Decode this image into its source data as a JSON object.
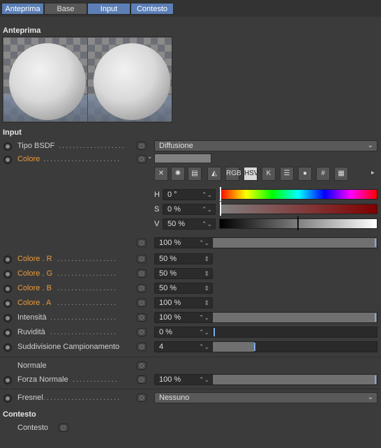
{
  "tabs": [
    {
      "label": "Anteprima",
      "active": true
    },
    {
      "label": "Base",
      "active": false
    },
    {
      "label": "Input",
      "active": true
    },
    {
      "label": "Contesto",
      "active": true
    }
  ],
  "preview": {
    "title": "Anteprima"
  },
  "input": {
    "title": "Input",
    "tipo_bsdf": {
      "label": "Tipo BSDF",
      "value": "Diffusione"
    },
    "colore": {
      "label": "Colore",
      "hsv": {
        "h_label": "H",
        "h_value": "0 °",
        "s_label": "S",
        "s_value": "0 %",
        "v_label": "V",
        "v_value": "50 %"
      },
      "brightness": "100 %",
      "tools": [
        "mixer-icon",
        "wheel-icon",
        "gradient-icon",
        "picture-icon",
        "RGB",
        "HSV",
        "K",
        "sliders-icon",
        "circle-icon",
        "#",
        "grid-icon"
      ]
    },
    "colore_r": {
      "label": "Colore . R",
      "value": "50 %"
    },
    "colore_g": {
      "label": "Colore . G",
      "value": "50 %"
    },
    "colore_b": {
      "label": "Colore . B",
      "value": "50 %"
    },
    "colore_a": {
      "label": "Colore . A",
      "value": "100 %"
    },
    "intensita": {
      "label": "Intensità",
      "value": "100 %",
      "level": 1.0
    },
    "ruvidita": {
      "label": "Ruvidità",
      "value": "0 %",
      "level": 0.0
    },
    "suddivisione": {
      "label": "Suddivisione Campionamento",
      "value": "4",
      "level": 0.25
    },
    "normale": {
      "label": "Normale"
    },
    "forza_normale": {
      "label": "Forza Normale",
      "value": "100 %",
      "level": 1.0
    },
    "fresnel": {
      "label": "Fresnel",
      "value": "Nessuno"
    }
  },
  "contesto": {
    "title": "Contesto",
    "label": "Contesto"
  },
  "colors": {
    "accent": "#5c7fb6",
    "orange_label": "#e99a3c",
    "slider_knob": "#7ea8e8"
  }
}
